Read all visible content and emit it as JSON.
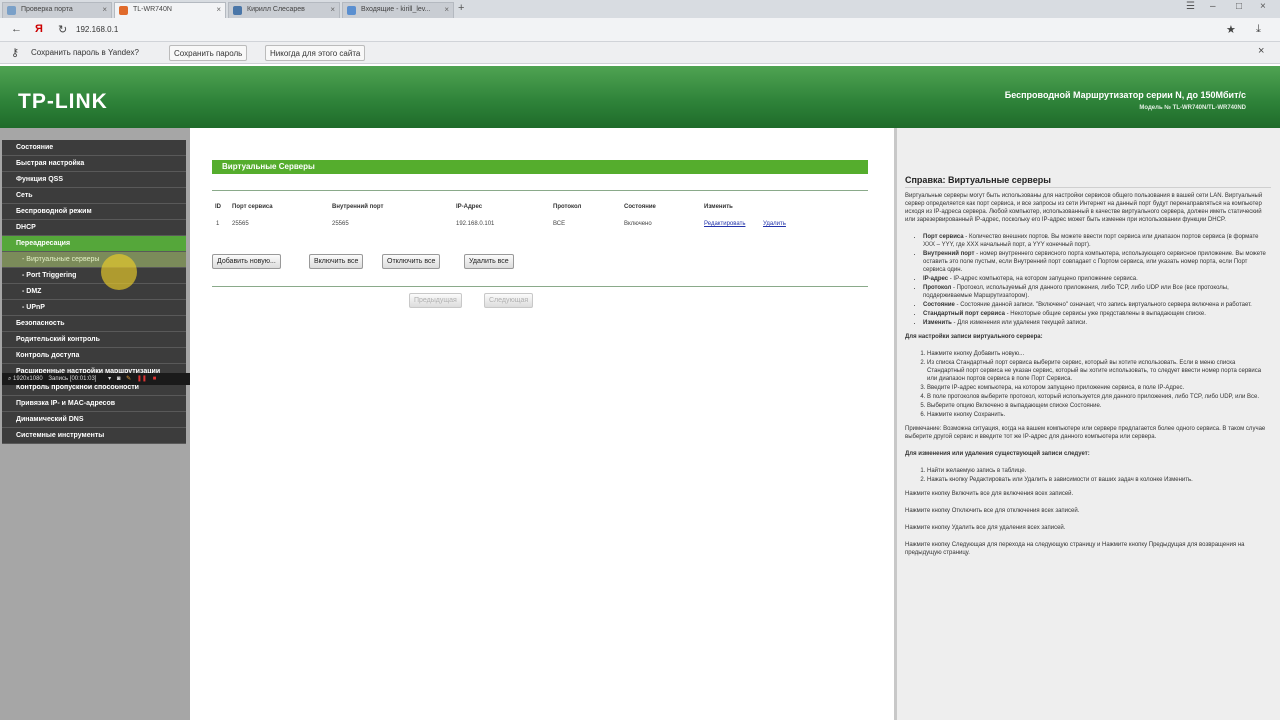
{
  "browser": {
    "tabs": [
      "Проверка порта",
      "TL-WR740N",
      "Кирилл Слесарев",
      "Входящие - kirill_lev..."
    ],
    "url": "192.168.0.1",
    "password_prompt": "Сохранить пароль в Yandex?",
    "save_password": "Сохранить пароль",
    "never_for_site": "Никогда для этого сайта"
  },
  "router": {
    "logo": "TP-LINK",
    "title": "Беспроводной Маршрутизатор серии N, до 150Мбит/с",
    "model": "Модель № TL-WR740N/TL-WR740ND"
  },
  "sidebar": {
    "items": [
      {
        "label": "Состояние"
      },
      {
        "label": "Быстрая настройка"
      },
      {
        "label": "Функция QSS"
      },
      {
        "label": "Сеть"
      },
      {
        "label": "Беспроводной режим"
      },
      {
        "label": "DHCP"
      },
      {
        "label": "Переадресация"
      },
      {
        "label": "- Виртуальные серверы"
      },
      {
        "label": "- Port Triggering"
      },
      {
        "label": "- DMZ"
      },
      {
        "label": "- UPnP"
      },
      {
        "label": "Безопасность"
      },
      {
        "label": "Родительский контроль"
      },
      {
        "label": "Контроль доступа"
      },
      {
        "label": "Расширенные настройки маршрутизации"
      },
      {
        "label": "Контроль пропускной способности"
      },
      {
        "label": "Привязка IP- и MAC-адресов"
      },
      {
        "label": "Динамический DNS"
      },
      {
        "label": "Системные инструменты"
      }
    ]
  },
  "recorder": {
    "resolution": "1920x1080",
    "status": "Запись [00:01:03]"
  },
  "main": {
    "title": "Виртуальные Серверы",
    "headers": [
      "ID",
      "Порт сервиса",
      "Внутренний порт",
      "IP-Адрес",
      "Протокол",
      "Состояние",
      "Изменить"
    ],
    "row": {
      "id": "1",
      "service_port": "25565",
      "internal_port": "25565",
      "ip": "192.168.0.101",
      "protocol": "ВСЕ",
      "status": "Включено",
      "edit": "Редактировать",
      "delete": "Удалить"
    },
    "buttons": {
      "add": "Добавить новую...",
      "enable_all": "Включить все",
      "disable_all": "Отключить все",
      "delete_all": "Удалить все",
      "prev": "Предыдущая",
      "next": "Следующая"
    }
  },
  "help": {
    "title": "Справка: Виртуальные серверы",
    "intro": "Виртуальные серверы могут быть использованы для настройки сервисов общего пользования в вашей сети LAN. Виртуальный сервер определяется как порт сервиса, и все запросы из сети Интернет на данный порт будут перенаправляться на компьютер исходя из IP-адреса сервера. Любой компьютер, использованный в качестве виртуального сервера, должен иметь статический или зарезервированный IP-адрес, поскольку его IP-адрес может быть изменен при использовании функции DHCP.",
    "bullets": [
      {
        "term": "Порт сервиса",
        "text": " - Количество внешних портов. Вы можете ввести порт сервиса или диапазон портов сервиса (в формате XXX – YYY, где XXX начальный порт, а YYY конечный порт)."
      },
      {
        "term": "Внутренний порт",
        "text": " - номер внутреннего сервисного порта компьютера, использующего сервисное приложение. Вы можете оставить это поле пустым, если Внутренний порт совпадает с Портом сервиса, или указать номер порта, если Порт сервиса один."
      },
      {
        "term": "IP-адрес",
        "text": " - IP-адрес компьютера, на котором запущено приложение сервиса."
      },
      {
        "term": "Протокол",
        "text": " - Протокол, используемый для данного приложения, либо TCP, либо UDP или Все (все протоколы, поддерживаемые Маршрутизатором)."
      },
      {
        "term": "Состояние",
        "text": " - Состояние данной записи. \"Включено\" означает, что запись виртуального сервера включена и работает."
      },
      {
        "term": "Стандартный порт сервиса",
        "text": " - Некоторые общие сервисы уже представлены в выпадающем списке."
      },
      {
        "term": "Изменить",
        "text": " - Для изменения или удаления текущей записи."
      }
    ],
    "setup_title": "Для настройки записи виртуального сервера:",
    "steps": [
      "Нажмите кнопку Добавить новую...",
      "Из списка Стандартный порт сервиса выберите сервис, который вы хотите использовать. Если в меню списка Стандартный порт сервиса не указан сервис, который вы хотите использовать, то следует ввести номер порта сервиса или диапазон портов сервиса в поле Порт Сервиса.",
      "Введите IP-адрес компьютера, на котором запущено приложение сервиса, в поле IP-Адрес.",
      "В поле протоколов выберите протокол, который используется для данного приложения, либо TCP, либо UDP, или Все.",
      "Выберите опцию Включено в выпадающем списке Состояние.",
      "Нажмите кнопку Сохранить."
    ],
    "note": "Примечание: Возможна ситуация, когда на вашем компьютере или сервере предлагается более одного сервиса. В таком случае выберите другой сервис и введите тот же IP-адрес для данного компьютера или сервера.",
    "modify_title": "Для изменения или удаления существующей записи следует:",
    "modify_steps": [
      "Найти желаемую запись в таблице.",
      "Нажать кнопку Редактировать или Удалить в зависимости от ваших задач в колонке Изменить."
    ],
    "p_enable": "Нажмите кнопку Включить все для включения всех записей.",
    "p_disable": "Нажмите кнопку Отключить все для отключения всех записей.",
    "p_delete": "Нажмите кнопку Удалить все для удаления всех записей.",
    "p_nav": "Нажмите кнопку Следующая для перехода на следующую страницу и Нажмите кнопку Предыдущая для возвращения на предыдущую страницу."
  }
}
